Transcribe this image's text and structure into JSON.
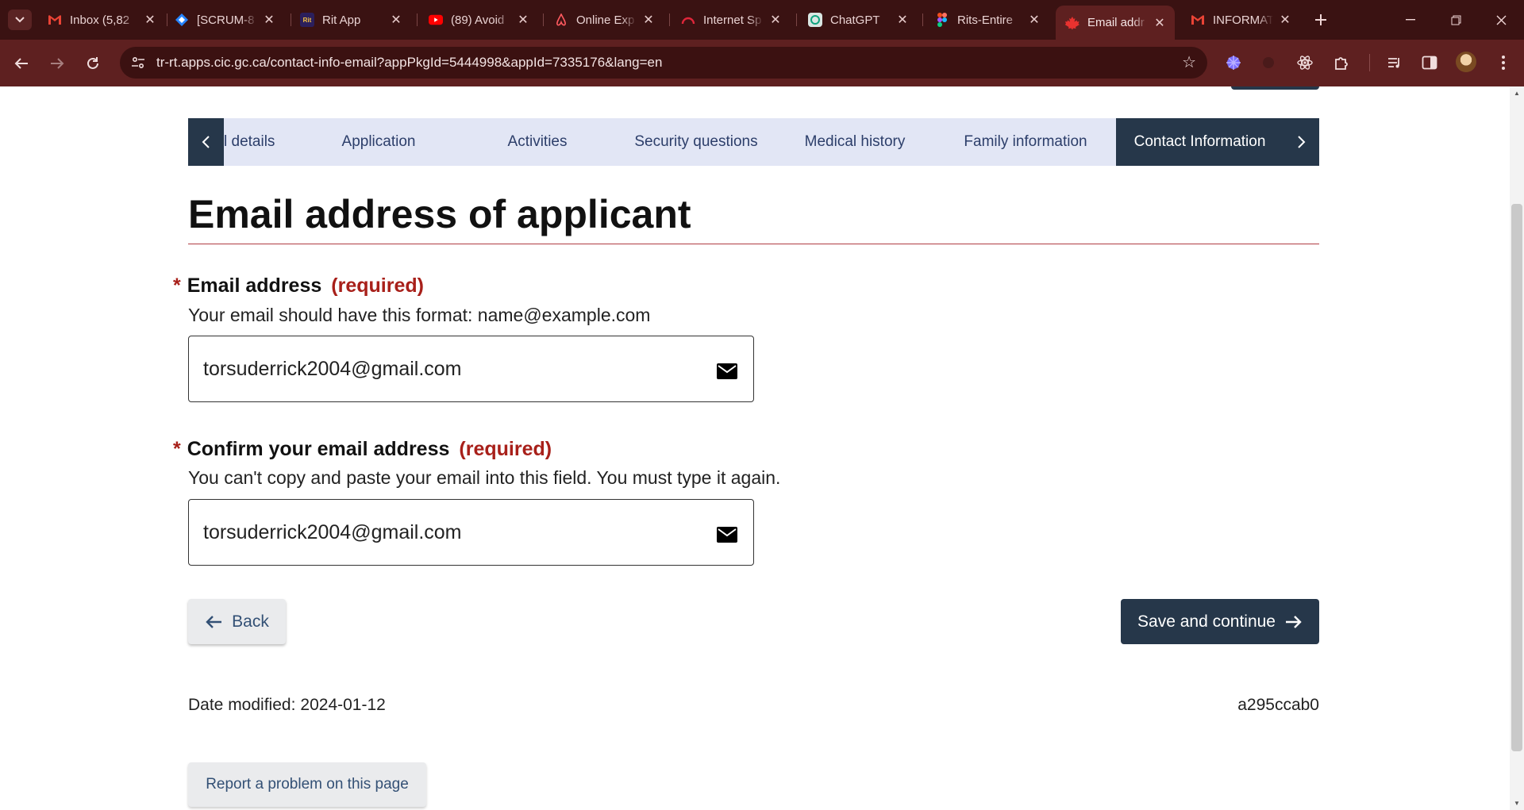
{
  "browser": {
    "tabs": [
      {
        "title": "Inbox (5,82",
        "icon": "gmail-icon",
        "active": false
      },
      {
        "title": "[SCRUM-8",
        "icon": "jira-icon",
        "active": false
      },
      {
        "title": "Rit App",
        "icon": "rit-app-icon",
        "active": false
      },
      {
        "title": "(89) Avoid",
        "icon": "youtube-icon",
        "active": false
      },
      {
        "title": "Online Exp",
        "icon": "airbnb-icon",
        "active": false
      },
      {
        "title": "Internet Sp",
        "icon": "speedtest-icon",
        "active": false
      },
      {
        "title": "ChatGPT",
        "icon": "chatgpt-icon",
        "active": false
      },
      {
        "title": "Rits-Entire",
        "icon": "figma-icon",
        "active": false
      },
      {
        "title": "Email addr",
        "icon": "canada-flag-icon",
        "active": true
      },
      {
        "title": "INFORMAT",
        "icon": "gmail-icon",
        "active": false
      }
    ],
    "rit_favicon_text": "Rit",
    "url": "tr-rt.apps.cic.gc.ca/contact-info-email?appPkgId=5444998&appId=7335176&lang=en",
    "colors": {
      "frame": "#3a1212",
      "toolbar": "#5e2020",
      "omnibox": "#3b1111"
    }
  },
  "steps": [
    {
      "label": "l details",
      "active": false
    },
    {
      "label": "Application",
      "active": false
    },
    {
      "label": "Activities",
      "active": false
    },
    {
      "label": "Security questions",
      "active": false
    },
    {
      "label": "Medical history",
      "active": false
    },
    {
      "label": "Family information",
      "active": false
    },
    {
      "label": "Contact Information",
      "active": true
    }
  ],
  "page": {
    "title": "Email address of applicant",
    "email": {
      "required_marker": "*",
      "label": "Email address",
      "required_text": "(required)",
      "hint": "Your email should have this format: name@example.com",
      "value": "torsuderrick2004@gmail.com"
    },
    "confirm_email": {
      "required_marker": "*",
      "label": "Confirm your email address",
      "required_text": "(required)",
      "hint": "You can't copy and paste your email into this field. You must type it again.",
      "value": "torsuderrick2004@gmail.com"
    },
    "back_label": "Back",
    "save_label": "Save and continue",
    "date_modified_label": "Date modified:",
    "date_modified_value": "2024-01-12",
    "version": "a295ccab0",
    "report_label": "Report a problem on this page",
    "colors": {
      "accent": "#26374a",
      "required": "#a8201a",
      "rule": "#af3c43",
      "stepbar": "#e2e6f5"
    }
  }
}
